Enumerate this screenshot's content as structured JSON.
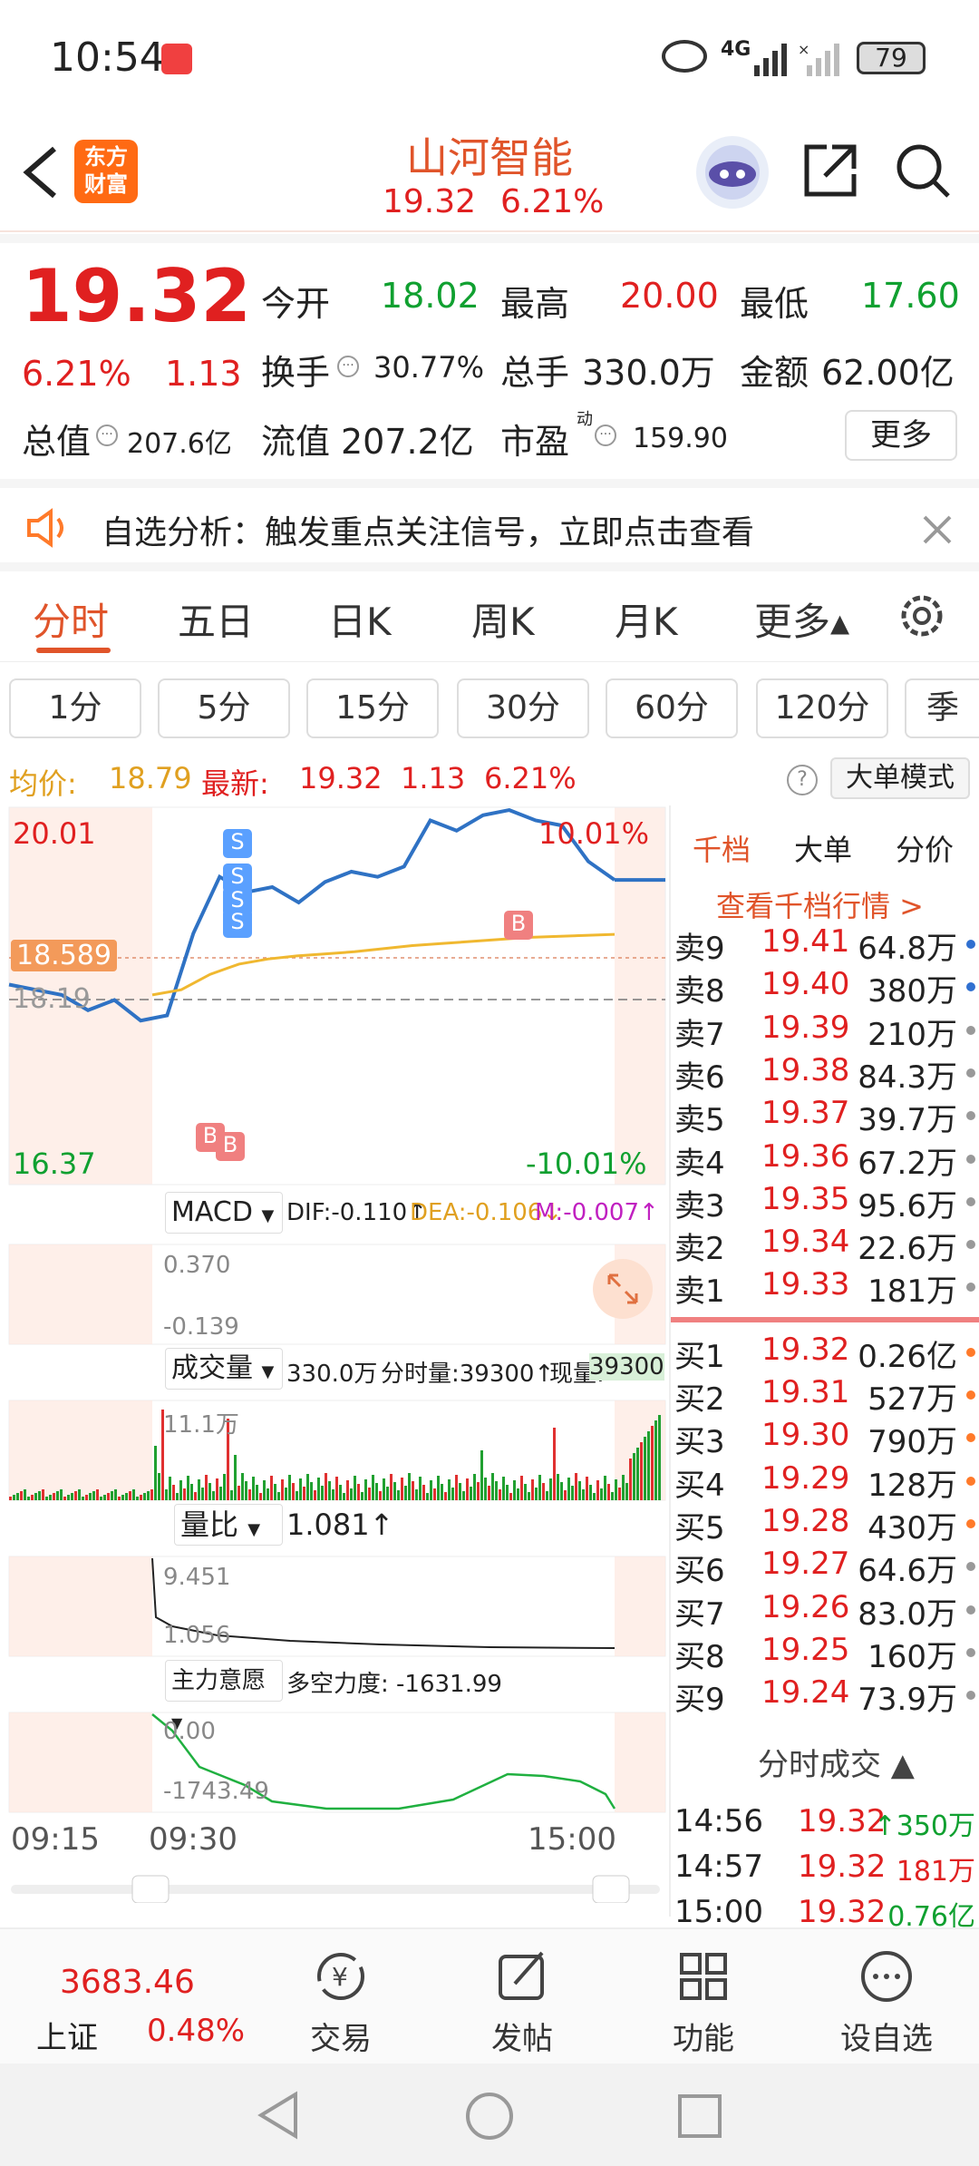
{
  "statusbar": {
    "time": "10:54",
    "battery": "79",
    "network": "4G"
  },
  "header": {
    "brand": "东方\n财富",
    "title": "山河智能",
    "price": "19.32",
    "change_pct": "6.21%"
  },
  "quote": {
    "price": "19.32",
    "change_pct": "6.21%",
    "change": "1.13",
    "open_label": "今开",
    "open": "18.02",
    "high_label": "最高",
    "high": "20.00",
    "low_label": "最低",
    "low": "17.60",
    "turnover_label": "换手",
    "turnover": "30.77%",
    "volume_label": "总手",
    "volume": "330.0万",
    "amount_label": "金额",
    "amount": "62.00亿",
    "mktcap_label": "总值",
    "mktcap": "207.6亿",
    "float_label": "流值",
    "float": "207.2亿",
    "pe_label": "市盈",
    "pe_mark": "动",
    "pe": "159.90",
    "more": "更多"
  },
  "banner": {
    "text": "自选分析：触发重点关注信号，立即点击查看"
  },
  "tabs": [
    "分时",
    "五日",
    "日K",
    "周K",
    "月K",
    "更多▴"
  ],
  "periods": [
    "1分",
    "5分",
    "15分",
    "30分",
    "60分",
    "120分",
    "季"
  ],
  "infoline": {
    "avg_label": "均价:",
    "avg": "18.79",
    "latest_label": "最新:",
    "latest": "19.32",
    "change": "1.13",
    "change_pct": "6.21%",
    "mode": "大单模式"
  },
  "chart": {
    "price_high": "20.01",
    "price_low": "16.37",
    "pct_high": "10.01%",
    "pct_low": "-10.01%",
    "avg_tag": "18.589",
    "prev_close": "18.19",
    "macd_label": "MACD",
    "dif": "DIF:-0.110↑",
    "dea": "DEA:-0.106↓",
    "m": "M:-0.007↑",
    "macd_top": "0.370",
    "macd_bottom": "-0.139",
    "vol_label": "成交量",
    "vol_total": "330.0万",
    "vol_tick": "分时量:39300↑",
    "vol_now_label": "现量:",
    "vol_now": "39300",
    "vol_max": "11.1万",
    "ratio_label": "量比",
    "ratio": "1.081↑",
    "ratio_top": "9.451",
    "ratio_bottom": "1.056",
    "force_label": "主力意愿",
    "force": "多空力度: -1631.99",
    "force_top": "0.00",
    "force_bottom": "-1743.49",
    "t1": "09:15",
    "t2": "09:30",
    "t3": "15:00",
    "markers": [
      "S",
      "S",
      "S",
      "S",
      "B",
      "B",
      "B"
    ]
  },
  "chart_data": {
    "type": "line",
    "title": "",
    "x": [
      "09:15",
      "09:30",
      "15:00"
    ],
    "ylim": [
      16.37,
      20.01
    ],
    "series": [
      {
        "values": [
          18.3,
          18.25,
          18.2,
          18.05,
          18.15,
          17.95,
          18.0,
          18.8,
          19.35,
          19.2,
          19.25,
          19.1,
          19.3,
          19.4,
          19.35,
          19.45,
          19.9,
          19.8,
          19.95,
          20.0,
          19.9,
          19.85,
          19.5,
          19.32
        ]
      },
      {
        "values": [
          18.2,
          18.25,
          18.4,
          18.5,
          18.55,
          18.58,
          18.6,
          18.62,
          18.65,
          18.68,
          18.7,
          18.72,
          18.74,
          18.76,
          18.77,
          18.78,
          18.79
        ]
      }
    ]
  },
  "book": {
    "tabs": [
      "千档",
      "大单",
      "分价"
    ],
    "link": "查看千档行情 >",
    "sells": [
      {
        "label": "卖9",
        "price": "19.41",
        "vol": "64.8万"
      },
      {
        "label": "卖8",
        "price": "19.40",
        "vol": "380万"
      },
      {
        "label": "卖7",
        "price": "19.39",
        "vol": "210万"
      },
      {
        "label": "卖6",
        "price": "19.38",
        "vol": "84.3万"
      },
      {
        "label": "卖5",
        "price": "19.37",
        "vol": "39.7万"
      },
      {
        "label": "卖4",
        "price": "19.36",
        "vol": "67.2万"
      },
      {
        "label": "卖3",
        "price": "19.35",
        "vol": "95.6万"
      },
      {
        "label": "卖2",
        "price": "19.34",
        "vol": "22.6万"
      },
      {
        "label": "卖1",
        "price": "19.33",
        "vol": "181万"
      }
    ],
    "buys": [
      {
        "label": "买1",
        "price": "19.32",
        "vol": "0.26亿"
      },
      {
        "label": "买2",
        "price": "19.31",
        "vol": "527万"
      },
      {
        "label": "买3",
        "price": "19.30",
        "vol": "790万"
      },
      {
        "label": "买4",
        "price": "19.29",
        "vol": "128万"
      },
      {
        "label": "买5",
        "price": "19.28",
        "vol": "430万"
      },
      {
        "label": "买6",
        "price": "19.27",
        "vol": "64.6万"
      },
      {
        "label": "买7",
        "price": "19.26",
        "vol": "83.0万"
      },
      {
        "label": "买8",
        "price": "19.25",
        "vol": "160万"
      },
      {
        "label": "买9",
        "price": "19.24",
        "vol": "73.9万"
      }
    ],
    "trades_title": "分时成交 ▲",
    "trades": [
      {
        "time": "14:56",
        "price": "19.32",
        "vol": "↑350万"
      },
      {
        "time": "14:57",
        "price": "19.32",
        "vol": "181万"
      },
      {
        "time": "15:00",
        "price": "19.32",
        "vol": "0.76亿"
      }
    ]
  },
  "bottomnav": {
    "index_value": "3683.46",
    "index_name": "上证",
    "index_pct": "0.48%",
    "items": [
      "交易",
      "发帖",
      "功能",
      "设自选"
    ]
  }
}
